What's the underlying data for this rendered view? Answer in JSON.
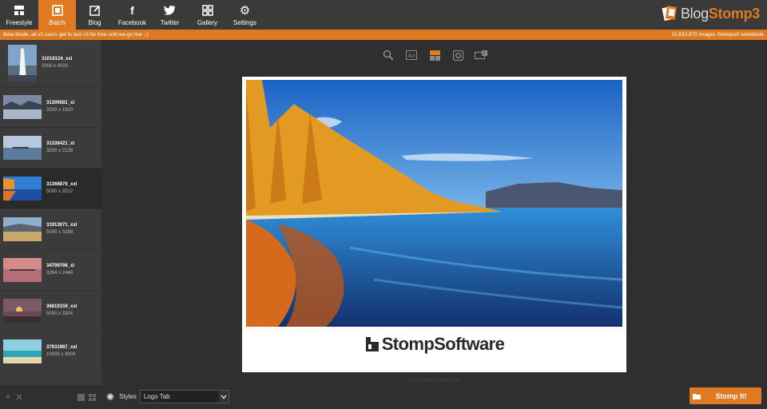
{
  "nav": {
    "items": [
      {
        "label": "Freestyle",
        "icon": "freestyle-icon"
      },
      {
        "label": "Batch",
        "icon": "batch-icon",
        "active": true
      },
      {
        "label": "Blog",
        "icon": "blog-icon"
      },
      {
        "label": "Facebook",
        "icon": "facebook-icon"
      },
      {
        "label": "Twitter",
        "icon": "twitter-icon"
      },
      {
        "label": "Gallery",
        "icon": "gallery-icon"
      },
      {
        "label": "Settings",
        "icon": "gear-icon"
      }
    ]
  },
  "logo": {
    "blog": "Blog",
    "stomp": "Stomp3"
  },
  "banner": {
    "left": "Beta Mode, all v2 users get to test v3 for free until we go live ;-)",
    "right": "15,633,972 images Stomped! worldwide"
  },
  "sidebar": {
    "items": [
      {
        "name": "31018124_xxl",
        "dims": "3000 x 4000"
      },
      {
        "name": "31309581_xl",
        "dims": "3200 x 1920"
      },
      {
        "name": "31338421_xl",
        "dims": "3200 x 2128"
      },
      {
        "name": "31368876_xxl",
        "dims": "5000 x 3312"
      },
      {
        "name": "31913071_xxl",
        "dims": "5000 x 3288"
      },
      {
        "name": "34799798_xl",
        "dims": "3264 x 2448"
      },
      {
        "name": "36819159_xxl",
        "dims": "5000 x 3304"
      },
      {
        "name": "37931987_xxl",
        "dims": "10000 x 3904"
      }
    ]
  },
  "canvas": {
    "brand": "StompSoftware",
    "view_note": "100% View (actual size)"
  },
  "styles": {
    "label": "Styles",
    "selected": "Logo Tab"
  },
  "stomp_button": {
    "label": "Stomp It!"
  },
  "colors": {
    "accent": "#e07a22",
    "background": "#2f2f2f"
  }
}
